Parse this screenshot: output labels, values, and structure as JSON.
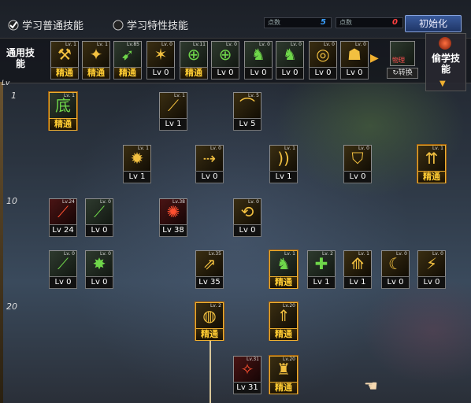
{
  "tabs": [
    {
      "label": "学习普通技能",
      "checked": true
    },
    {
      "label": "学习特性技能",
      "checked": false
    }
  ],
  "stats": [
    {
      "label": "点数",
      "value": "5",
      "color": "#3aa0ff"
    },
    {
      "label": "点数",
      "value": "0",
      "color": "#ff4040"
    }
  ],
  "reset_label": "初始化",
  "category": {
    "label": "通用技能"
  },
  "right_category": {
    "label": "偷学技能"
  },
  "swap": {
    "label": "转换",
    "tag": "物理"
  },
  "level_marks": [
    "Lv",
    "1",
    "10",
    "20"
  ],
  "top_row": [
    {
      "lv": "Lv. 1",
      "caption": "精通",
      "elite": true,
      "glyph": "⚒",
      "c": "gold"
    },
    {
      "lv": "Lv. 1",
      "caption": "精通",
      "elite": true,
      "glyph": "✦",
      "c": "gold"
    },
    {
      "lv": "Lv.85",
      "caption": "精通",
      "elite": true,
      "glyph": "➹",
      "c": "green"
    },
    {
      "lv": "Lv. 0",
      "caption": "Lv 0",
      "elite": false,
      "glyph": "✶",
      "c": "gold"
    },
    {
      "lv": "Lv.11",
      "caption": "精通",
      "elite": true,
      "glyph": "⊕",
      "c": "green"
    },
    {
      "lv": "Lv. 0",
      "caption": "Lv 0",
      "elite": false,
      "glyph": "⊕",
      "c": "green"
    },
    {
      "lv": "Lv. 0",
      "caption": "Lv 0",
      "elite": false,
      "glyph": "♞",
      "c": "green"
    },
    {
      "lv": "Lv. 0",
      "caption": "Lv 0",
      "elite": false,
      "glyph": "♞",
      "c": "green"
    },
    {
      "lv": "Lv. 0",
      "caption": "Lv 0",
      "elite": false,
      "glyph": "◎",
      "c": "gold"
    },
    {
      "lv": "Lv. 0",
      "caption": "Lv 0",
      "elite": false,
      "glyph": "☗",
      "c": "gold"
    }
  ],
  "grid": [
    {
      "lv": "Lv. 1",
      "caption": "精通",
      "elite": true,
      "glyph": "底",
      "c": "green",
      "hl": true
    },
    {
      "lv": "Lv. 1",
      "caption": "Lv 1",
      "elite": false,
      "glyph": "⟋",
      "c": "gold"
    },
    {
      "lv": "Lv. 5",
      "caption": "Lv 5",
      "elite": false,
      "glyph": "⌒",
      "c": "gold"
    },
    {
      "lv": "Lv. 1",
      "caption": "Lv 1",
      "elite": false,
      "glyph": "✹",
      "c": "gold"
    },
    {
      "lv": "Lv. 0",
      "caption": "Lv 0",
      "elite": false,
      "glyph": "⇢",
      "c": "gold"
    },
    {
      "lv": "Lv. 1",
      "caption": "Lv 1",
      "elite": false,
      "glyph": "))",
      "c": "gold"
    },
    {
      "lv": "Lv. 0",
      "caption": "Lv 0",
      "elite": false,
      "glyph": "⛉",
      "c": "gold"
    },
    {
      "lv": "Lv. 1",
      "caption": "精通",
      "elite": true,
      "glyph": "⇈",
      "c": "gold",
      "hl": true
    },
    {
      "lv": "Lv.24",
      "caption": "Lv 24",
      "elite": false,
      "glyph": "⟋",
      "c": "red"
    },
    {
      "lv": "Lv. 0",
      "caption": "Lv 0",
      "elite": false,
      "glyph": "⟋",
      "c": "green"
    },
    {
      "lv": "Lv.38",
      "caption": "Lv 38",
      "elite": false,
      "glyph": "✺",
      "c": "red"
    },
    {
      "lv": "Lv. 0",
      "caption": "Lv 0",
      "elite": false,
      "glyph": "⟲",
      "c": "gold"
    },
    {
      "lv": "Lv. 0",
      "caption": "Lv 0",
      "elite": false,
      "glyph": "⟋",
      "c": "green"
    },
    {
      "lv": "Lv. 0",
      "caption": "Lv 0",
      "elite": false,
      "glyph": "✸",
      "c": "green"
    },
    {
      "lv": "Lv.35",
      "caption": "Lv 35",
      "elite": false,
      "glyph": "⇗",
      "c": "gold"
    },
    {
      "lv": "Lv. 1",
      "caption": "精通",
      "elite": true,
      "glyph": "♞",
      "c": "green",
      "hl": true
    },
    {
      "lv": "Lv. 2",
      "caption": "Lv 1",
      "elite": false,
      "glyph": "✚",
      "c": "green"
    },
    {
      "lv": "Lv. 1",
      "caption": "Lv 1",
      "elite": false,
      "glyph": "⟰",
      "c": "gold"
    },
    {
      "lv": "Lv. 0",
      "caption": "Lv 0",
      "elite": false,
      "glyph": "☾",
      "c": "gold"
    },
    {
      "lv": "Lv. 0",
      "caption": "Lv 0",
      "elite": false,
      "glyph": "⚡",
      "c": "gold"
    },
    {
      "lv": "Lv. 2",
      "caption": "精通",
      "elite": true,
      "glyph": "◍",
      "c": "gold",
      "hl": true
    },
    {
      "lv": "Lv.20",
      "caption": "精通",
      "elite": true,
      "glyph": "⇑",
      "c": "gold",
      "hl": true
    },
    {
      "lv": "Lv.31",
      "caption": "Lv 31",
      "elite": false,
      "glyph": "✧",
      "c": "red"
    },
    {
      "lv": "Lv.20",
      "caption": "精通",
      "elite": true,
      "glyph": "♜",
      "c": "gold",
      "hl": true
    }
  ]
}
